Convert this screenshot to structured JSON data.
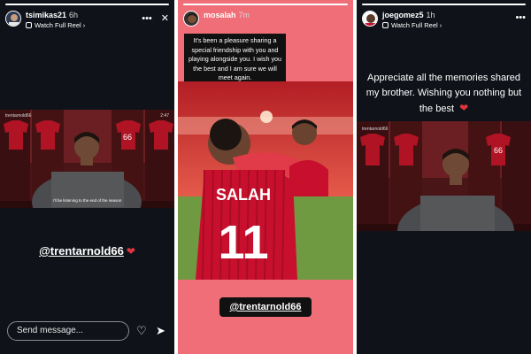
{
  "story1": {
    "username": "tsimikas21",
    "time": "6h",
    "reel_label": "Watch Full Reel",
    "video_top_left": "trentarnold66",
    "video_time": "2:47",
    "video_caption": "I'll be listening to the end of the season",
    "mention": "@trentarnold66",
    "send_placeholder": "Send message..."
  },
  "story2": {
    "username": "mosalah",
    "time": "7m",
    "message": "It's been a pleasure sharing a special friendship with you and playing alongside you. I wish you the best and I am sure we will meet again.",
    "shirt_name": "SALAH",
    "shirt_number": "11",
    "mention": "@trentarnold66"
  },
  "story3": {
    "username": "joegomez5",
    "time": "1h",
    "reel_label": "Watch Full Reel",
    "message": "Appreciate all the memories shared my brother. Wishing you nothing but the best",
    "video_top_left": "trentarnold66"
  },
  "colors": {
    "dark_bg": "#0f1319",
    "story_pink": "#f06e78",
    "heart": "#e0353f",
    "kit_red": "#c8102e"
  },
  "icons": [
    "reel-icon",
    "more-icon",
    "close-icon",
    "heart-icon",
    "send-icon"
  ]
}
